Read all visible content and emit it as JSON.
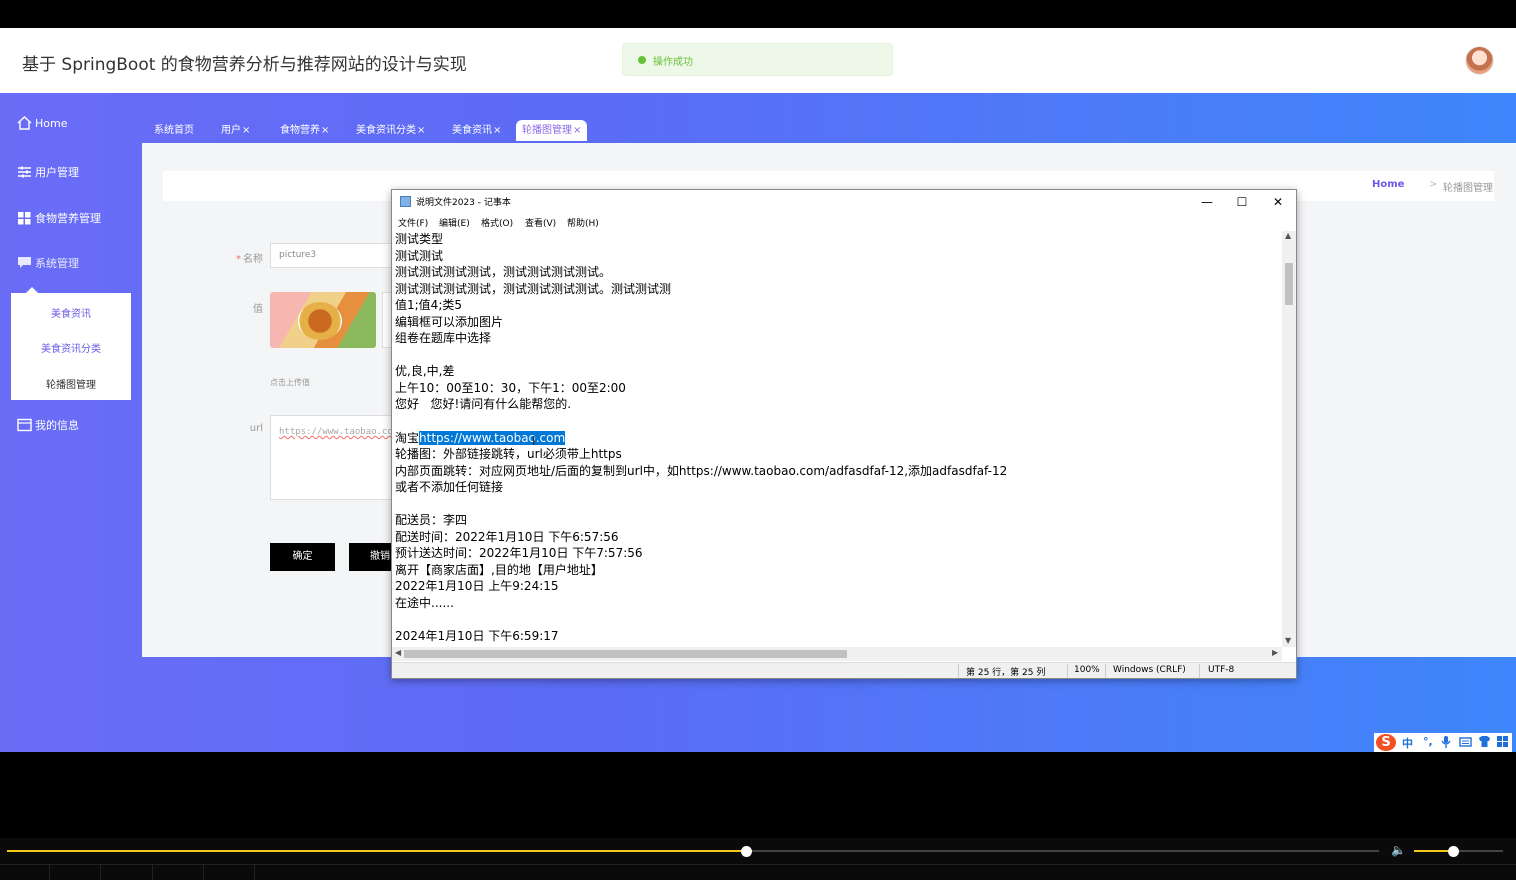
{
  "header": {
    "title": "基于 SpringBoot 的食物营养分析与推荐网站的设计与实现",
    "toast": "操作成功",
    "avatar_icon": "user-avatar"
  },
  "sidebar": {
    "items": [
      {
        "label": "Home",
        "icon": "home-icon"
      },
      {
        "label": "用户管理",
        "icon": "sliders-icon"
      },
      {
        "label": "食物营养管理",
        "icon": "grid-icon"
      },
      {
        "label": "系统管理",
        "icon": "chat-icon"
      },
      {
        "label": "我的信息",
        "icon": "card-icon"
      }
    ],
    "submenu": [
      "美食资讯",
      "美食资讯分类",
      "轮播图管理"
    ]
  },
  "tabs": [
    {
      "label": "系统首页",
      "close": ""
    },
    {
      "label": "用户",
      "close": "×"
    },
    {
      "label": "食物营养",
      "close": "×"
    },
    {
      "label": "美食资讯分类",
      "close": "×"
    },
    {
      "label": "美食资讯",
      "close": "×"
    },
    {
      "label": "轮播图管理",
      "close": "×"
    }
  ],
  "breadcrumb": {
    "home": "Home",
    "separator": ">",
    "current": "轮播图管理"
  },
  "form": {
    "name_label": "名称",
    "name_required": "*",
    "name_value": "picture3",
    "value_label": "值",
    "upload_tip": "点击上传值",
    "url_label": "url",
    "url_value": "https://www.taobao.com",
    "confirm": "确定",
    "cancel": "撤销"
  },
  "notepad": {
    "title": "说明文件2023 - 记事本",
    "menu": [
      "文件(F)",
      "编辑(E)",
      "格式(O)",
      "查看(V)",
      "帮助(H)"
    ],
    "lines": [
      "测试类型",
      "测试测试",
      "测试测试测试测试，测试测试测试测试。",
      "测试测试测试测试，测试测试测试测试。测试测试测",
      "值1;值4;类5",
      "编辑框可以添加图片",
      "组卷在题库中选择",
      "",
      "优,良,中,差",
      "上午10：00至10：30，下午1：00至2:00",
      "您好   您好!请问有什么能帮您的.",
      "",
      "淘宝",
      "轮播图：外部链接跳转，url必须带上https",
      "内部页面跳转：对应网页地址/后面的复制到url中，如https://www.taobao.com/adfasdfaf-12,添加adfasdfaf-12",
      "或者不添加任何链接",
      "",
      "配送员：李四",
      "配送时间：2022年1月10日 下午6:57:56",
      "预计送达时间：2022年1月10日 下午7:57:56",
      "离开【商家店面】,目的地【用户地址】",
      "2022年1月10日 上午9:24:15",
      "在途中......",
      "",
      "2024年1月10日 下午6:59:17"
    ],
    "selected_text": "https://www.taobao.com",
    "status": {
      "position": "第 25 行，第 25 列",
      "zoom": "100%",
      "line_ending": "Windows (CRLF)",
      "encoding": "UTF-8"
    },
    "window_buttons": {
      "minimize": "—",
      "maximize": "☐",
      "close": "✕"
    }
  },
  "ime": {
    "logo": "S",
    "items": [
      "中",
      "°,",
      "🎤",
      "⌨",
      "👕",
      "▦"
    ]
  },
  "player": {
    "progress_fraction": 0.54,
    "volume_fraction": 0.44
  }
}
